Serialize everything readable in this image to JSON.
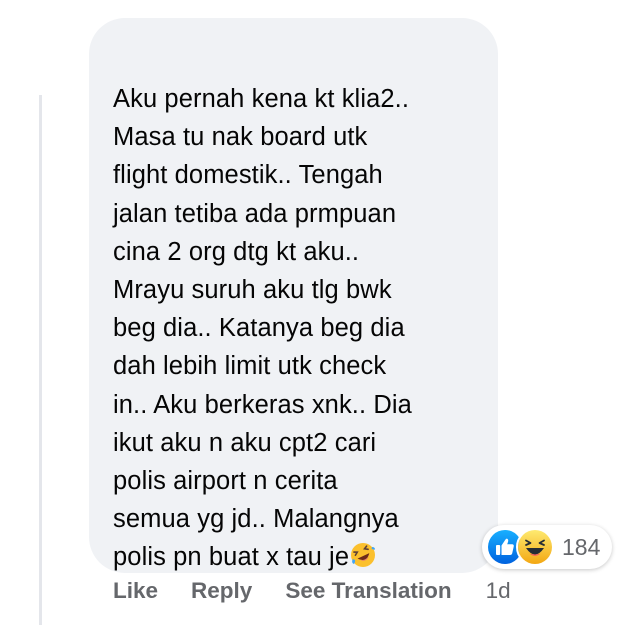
{
  "comment": {
    "lines": [
      "Aku pernah kena kt klia2..",
      "Masa tu nak board utk",
      "flight domestik.. Tengah",
      "jalan tetiba ada prmpuan",
      "cina 2 org dtg kt aku..",
      "Mrayu suruh aku tlg bwk",
      "beg dia.. Katanya beg dia",
      "dah lebih limit utk check",
      "in.. Aku berkeras xnk.. Dia",
      "ikut aku n aku cpt2 cari",
      "polis airport n cerita",
      "semua yg jd.. Malangnya",
      "polis pn buat x tau je"
    ],
    "trailing_emoji": "rolling-on-floor-laughing-emoji"
  },
  "reactions": {
    "icons": [
      "like-reaction-icon",
      "haha-reaction-icon"
    ],
    "count": "184",
    "colors": {
      "like": "#1877f2",
      "haha": "#f7b125"
    }
  },
  "actions": {
    "like": "Like",
    "reply": "Reply",
    "see_translation": "See Translation",
    "timestamp": "1d"
  },
  "colors": {
    "bubble_bg": "#f0f2f5",
    "text": "#050505",
    "secondary_text": "#65676b"
  }
}
